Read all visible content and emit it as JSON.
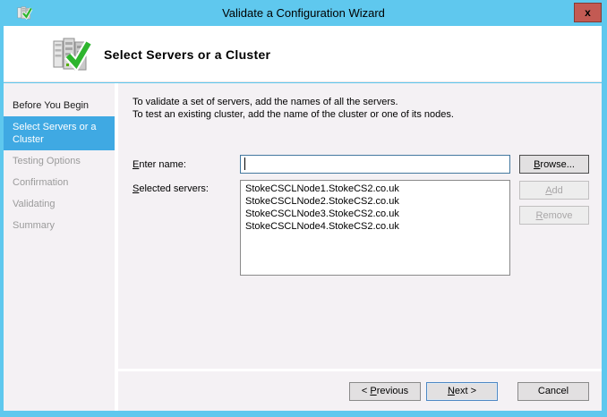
{
  "window": {
    "title": "Validate a Configuration Wizard",
    "close_label": "x"
  },
  "header": {
    "title": "Select Servers or a Cluster"
  },
  "sidebar": {
    "items": [
      {
        "label": "Before You Begin",
        "state": "done"
      },
      {
        "label": "Select Servers or a Cluster",
        "state": "active"
      },
      {
        "label": "Testing Options",
        "state": "pending"
      },
      {
        "label": "Confirmation",
        "state": "pending"
      },
      {
        "label": "Validating",
        "state": "pending"
      },
      {
        "label": "Summary",
        "state": "pending"
      }
    ]
  },
  "main": {
    "instructions": [
      "To validate a set of servers, add the names of all the servers.",
      "To test an existing cluster, add the name of the cluster or one of its nodes."
    ],
    "enter_name_label": {
      "pre": "",
      "key": "E",
      "rest": "nter name:"
    },
    "enter_name_value": "",
    "selected_servers_label": {
      "pre": "",
      "key": "S",
      "rest": "elected servers:"
    },
    "selected_servers": [
      "StokeCSCLNode1.StokeCS2.co.uk",
      "StokeCSCLNode2.StokeCS2.co.uk",
      "StokeCSCLNode3.StokeCS2.co.uk",
      "StokeCSCLNode4.StokeCS2.co.uk"
    ],
    "buttons": {
      "browse": {
        "pre": "",
        "key": "B",
        "rest": "rowse..."
      },
      "add": {
        "pre": "",
        "key": "A",
        "rest": "dd"
      },
      "remove": {
        "pre": "",
        "key": "R",
        "rest": "emove"
      }
    }
  },
  "footer": {
    "previous": {
      "pre": "< ",
      "key": "P",
      "rest": "revious"
    },
    "next": {
      "pre": "",
      "key": "N",
      "rest": "ext >"
    },
    "cancel": {
      "pre": "",
      "key": "",
      "rest": "Cancel"
    }
  },
  "colors": {
    "titlebar": "#5fc8ee",
    "active_item": "#3fa9e3",
    "close_button": "#c35a53",
    "focused_input_border": "#43789f",
    "content_background": "#f4f1f4"
  }
}
